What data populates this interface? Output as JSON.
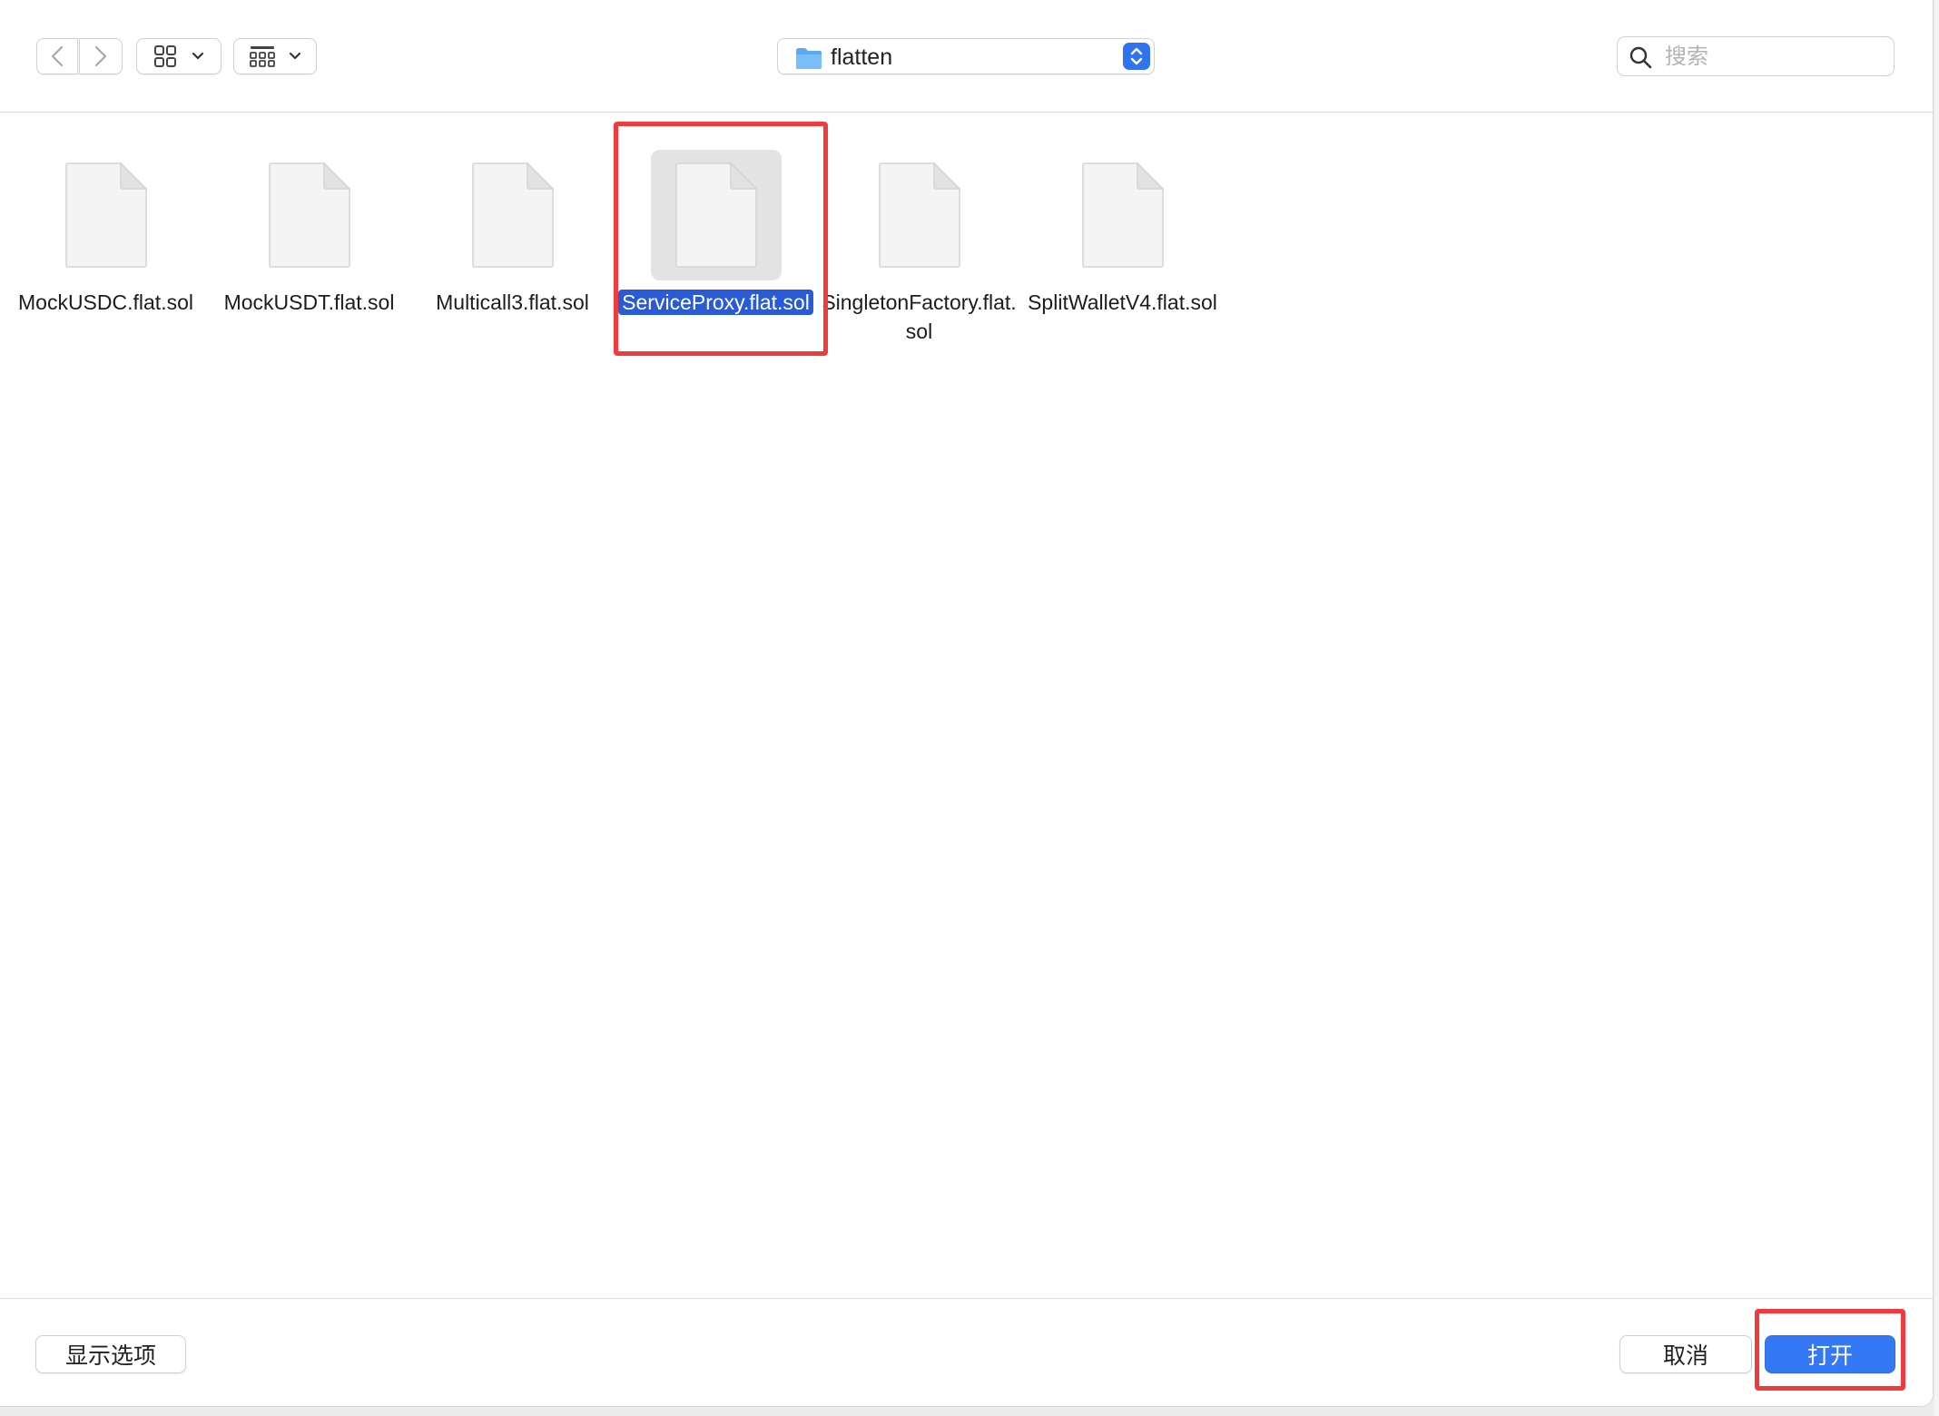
{
  "toolbar": {
    "back_icon": "chevron-left-icon",
    "forward_icon": "chevron-right-icon",
    "view_mode_icon": "icon-grid-icon",
    "group_icon": "group-by-icon",
    "path": {
      "label": "flatten",
      "icon": "folder-icon",
      "icon_color": "#5aa9f5"
    },
    "search": {
      "placeholder": "搜索",
      "value": ""
    }
  },
  "files": [
    {
      "name": "MockUSDC.flat.sol",
      "selected": false
    },
    {
      "name": "MockUSDT.flat.sol",
      "selected": false
    },
    {
      "name": "Multicall3.flat.sol",
      "selected": false
    },
    {
      "name": "ServiceProxy.flat.sol",
      "selected": true
    },
    {
      "name": "SingletonFactory.flat.sol",
      "selected": false
    },
    {
      "name": "SplitWalletV4.flat.sol",
      "selected": false
    }
  ],
  "footer": {
    "options_label": "显示选项",
    "cancel_label": "取消",
    "open_label": "打开"
  },
  "colors": {
    "accent": "#3478f6",
    "selection": "#2a5bd7",
    "highlight_annotation": "#f03a3e"
  }
}
